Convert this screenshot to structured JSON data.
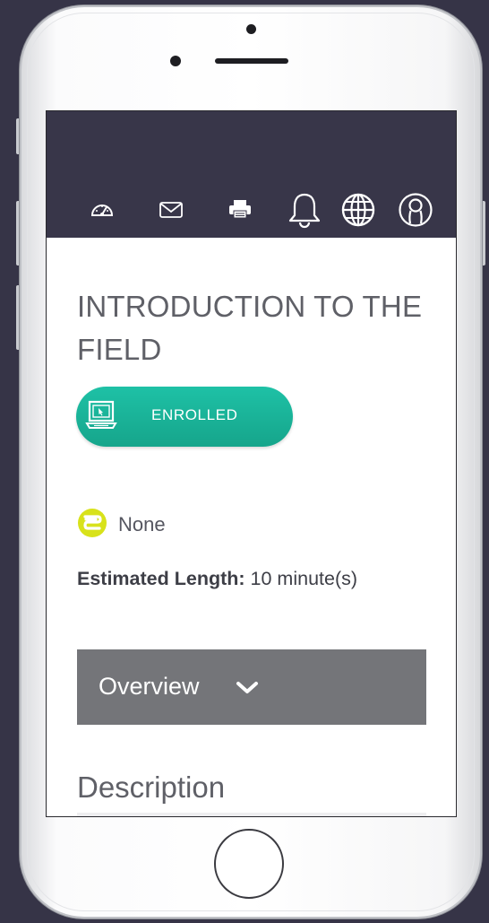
{
  "course": {
    "title": "INTRODUCTION TO THE FIELD",
    "enrollment_status": "ENROLLED"
  },
  "credit": {
    "value": "None"
  },
  "estimated_length": {
    "label": "Estimated Length:",
    "value": "10 minute(s)"
  },
  "overview": {
    "label": "Overview"
  },
  "description": {
    "heading": "Description"
  },
  "nav": {
    "icons": [
      "dashboard-icon",
      "mail-icon",
      "print-icon",
      "bell-icon",
      "globe-icon",
      "user-icon"
    ]
  },
  "colors": {
    "topbar": "#383649",
    "accent_teal": "#19b397",
    "overview_gray": "#747579",
    "credit_yellow": "#d8e21a",
    "background": "#363447"
  }
}
